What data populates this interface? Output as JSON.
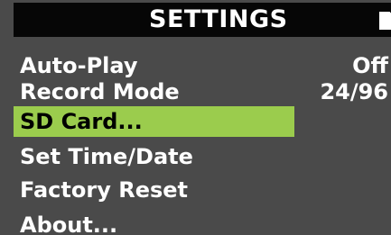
{
  "header": {
    "title": "SETTINGS",
    "icon": "sd-card-icon"
  },
  "menu": {
    "items": [
      {
        "label": "Auto-Play",
        "value": "Off"
      },
      {
        "label": "Record Mode",
        "value": "24/96"
      },
      {
        "label": "SD Card...",
        "value": ""
      },
      {
        "label": "Set Time/Date",
        "value": ""
      },
      {
        "label": "Factory Reset",
        "value": ""
      },
      {
        "label": "About...",
        "value": ""
      }
    ],
    "selected_index": 2
  },
  "colors": {
    "background": "#4a4a4a",
    "header_background": "#060606",
    "text": "#ffffff",
    "selection": "#9bcc4d",
    "selection_text": "#000000"
  }
}
